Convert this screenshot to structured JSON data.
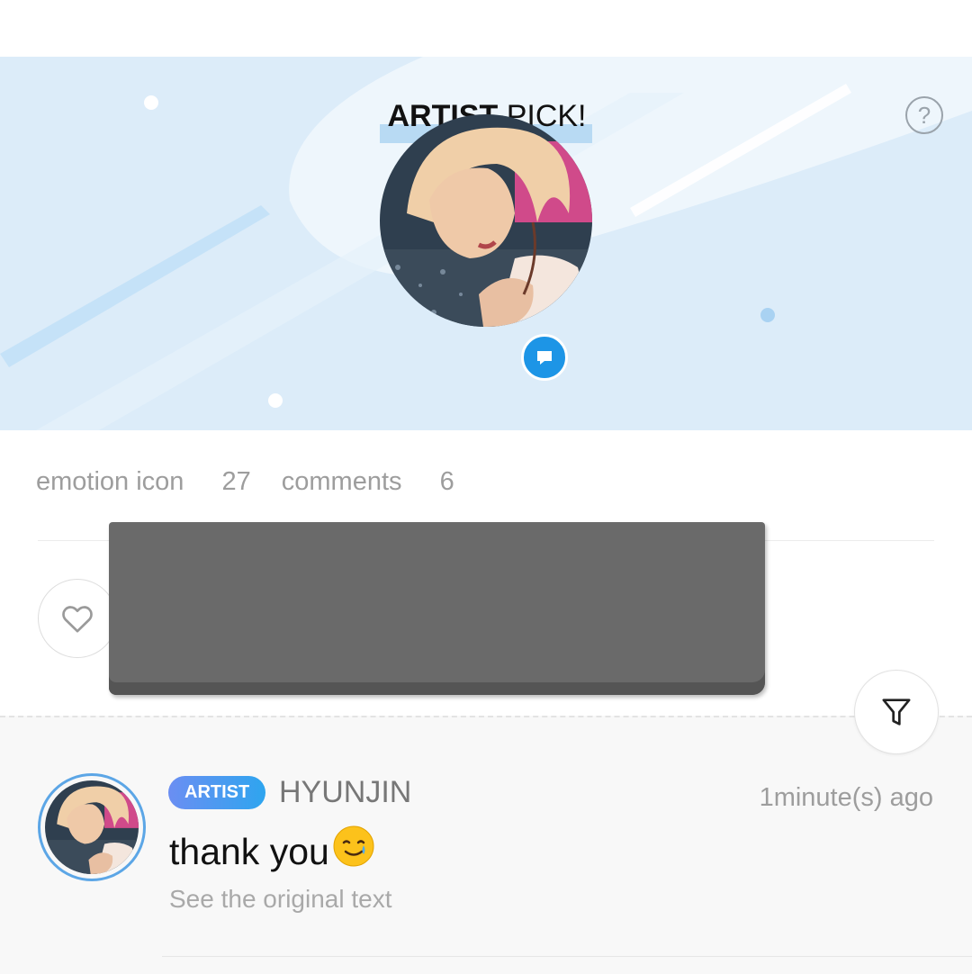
{
  "banner": {
    "title_bold": "ARTIST",
    "title_rest": "PICK!",
    "help_icon": "question-mark-circle-icon"
  },
  "stats": {
    "emotion_label": "emotion icon",
    "emotion_count": "27",
    "comments_label": "comments",
    "comments_count": "6"
  },
  "actions": {
    "like_icon": "heart-outline-icon",
    "filter_icon": "funnel-filter-icon"
  },
  "comment": {
    "badge": "ARTIST",
    "author": "HYUNJIN",
    "time": "1minute(s) ago",
    "text": "thank you",
    "emoji": "smiling-face-with-tear",
    "translate_link": "See the original text"
  },
  "colors": {
    "banner_bg": "#dcecf9",
    "accent_blue": "#1d95e6",
    "badge_gradient_start": "#6b8ef2",
    "badge_gradient_end": "#2ea5ef"
  }
}
